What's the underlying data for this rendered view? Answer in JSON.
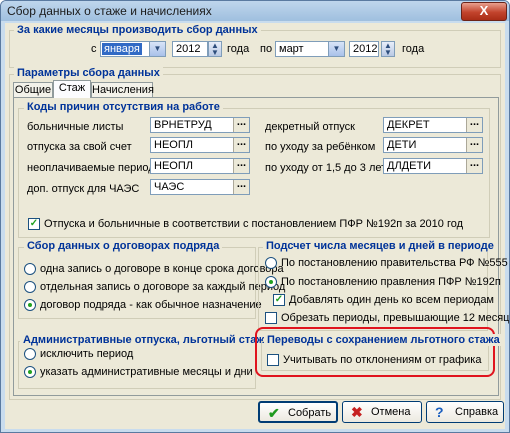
{
  "window": {
    "title": "Сбор данных о стаже и начислениях",
    "close_label": "X"
  },
  "period": {
    "group_title": "За какие месяцы производить сбор данных",
    "from_label": "с",
    "from_month": "января",
    "from_year": "2012",
    "year_label_1": "года",
    "to_label": "по",
    "to_month": "март",
    "to_year": "2012",
    "year_label_2": "года"
  },
  "params": {
    "group_title": "Параметры сбора данных"
  },
  "tabs": [
    {
      "label": "Общие"
    },
    {
      "label": "Стаж"
    },
    {
      "label": "Начисления"
    }
  ],
  "absence": {
    "group_title": "Коды причин отсутствия на работе",
    "left": [
      {
        "label": "больничные листы",
        "value": "ВРНЕТРУД"
      },
      {
        "label": "отпуска за свой счет",
        "value": "НЕОПЛ"
      },
      {
        "label": "неоплачиваемые периоды",
        "value": "НЕОПЛ"
      },
      {
        "label": "доп. отпуск для ЧАЭС",
        "value": "ЧАЭС"
      }
    ],
    "right": [
      {
        "label": "декретный отпуск",
        "value": "ДЕКРЕТ"
      },
      {
        "label": "по уходу за ребёнком",
        "value": "ДЕТИ"
      },
      {
        "label": "по уходу от 1,5 до 3 лет",
        "value": "ДЛДЕТИ"
      }
    ],
    "pfr_check_label": "Отпуска и больничные в соответствии с постановлением ПФР №192п за 2010 год"
  },
  "contracts": {
    "group_title": "Сбор данных о договорах подряда",
    "options": [
      "одна запись о договоре в конце срока договора",
      "отдельная запись о договоре за каждый период",
      "договор подряда - как обычное назначение"
    ]
  },
  "months": {
    "group_title": "Подсчет числа месяцев и дней в периоде",
    "options": [
      "По постановлению правительства РФ №555",
      "По постановлению правления ПФР №192п"
    ],
    "add_day_label": "Добавлять один день ко всем периодам",
    "trim_label": "Обрезать периоды, превышающие 12 месяцев"
  },
  "admin": {
    "group_title": "Административные отпуска, льготный стаж",
    "options": [
      "исключить период",
      "указать административные месяцы и дни"
    ]
  },
  "transfers": {
    "group_title": "Переводы с сохранением льготного стажа",
    "check_label": "Учитывать по отклонениям от графика"
  },
  "buttons": {
    "save": "Собрать",
    "cancel": "Отмена",
    "help": "Справка"
  },
  "colors": {
    "highlight": "#e0141e",
    "group_title": "#003399",
    "selection": "#316ac5"
  }
}
